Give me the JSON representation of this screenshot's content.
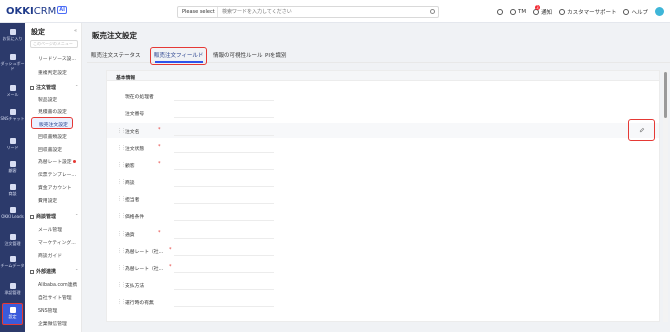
{
  "app": {
    "logo_main": "OKKI",
    "logo_crm": "CRM",
    "logo_ai": "AI"
  },
  "topbar": {
    "search_select": "Please select",
    "search_placeholder": "検索ワードを入力してください",
    "user": "TM",
    "notice": "通知",
    "notice_badge": "3",
    "support": "カスタマーサポート",
    "help": "ヘルプ"
  },
  "rail": {
    "items": [
      {
        "label": "お気に入り",
        "icon": "star-icon"
      },
      {
        "label": "ダッシュボード",
        "icon": "dashboard-icon"
      },
      {
        "label": "メール",
        "icon": "mail-icon"
      },
      {
        "label": "SNSチャット",
        "icon": "chat-icon"
      },
      {
        "label": "リード",
        "icon": "lead-icon"
      },
      {
        "label": "顧客",
        "icon": "customer-icon"
      },
      {
        "label": "商談",
        "icon": "deal-icon"
      },
      {
        "label": "OKKI Leads",
        "icon": "leads-icon"
      },
      {
        "label": "注文管理",
        "icon": "order-icon"
      },
      {
        "label": "チームデータ",
        "icon": "team-icon"
      },
      {
        "label": "承認管理",
        "icon": "approval-icon"
      },
      {
        "label": "設定",
        "icon": "settings-icon"
      }
    ]
  },
  "sidebar": {
    "title": "設定",
    "search_placeholder": "このページのメニュー",
    "items_top": [
      "リードソース設...",
      "重複判定設定"
    ],
    "groups": [
      {
        "label": "注文管理",
        "items": [
          "製品設定",
          "見積書の設定",
          "販売注文設定",
          "回収書類設定",
          "回収書設定",
          "為替レート設定",
          "伝票テンプレー...",
          "資金アカウント",
          "費用設定"
        ]
      },
      {
        "label": "商談管理",
        "items": [
          "メール管理",
          "マーケティング...",
          "商談ガイド"
        ]
      },
      {
        "label": "外部連携",
        "items": [
          "Alibaba.com連携",
          "自社サイト管理",
          "SNS管理",
          "企業微信管理"
        ]
      }
    ]
  },
  "main": {
    "title": "販売注文設定",
    "tabs": [
      "販売注文ステータス",
      "販売注文フィールド",
      "情報の可視性ルール",
      "PIを識別"
    ],
    "active_tab": 1,
    "section_title": "基本情報",
    "fields": [
      {
        "label": "現在の処理者",
        "required": false,
        "draggable": false
      },
      {
        "label": "注文番号",
        "required": false,
        "draggable": false
      },
      {
        "label": "注文名",
        "required": true,
        "draggable": true
      },
      {
        "label": "注文状態",
        "required": true,
        "draggable": true
      },
      {
        "label": "顧客",
        "required": true,
        "draggable": true
      },
      {
        "label": "商談",
        "required": false,
        "draggable": true
      },
      {
        "label": "担当者",
        "required": false,
        "draggable": true
      },
      {
        "label": "価格条件",
        "required": false,
        "draggable": true
      },
      {
        "label": "通貨",
        "required": true,
        "draggable": true
      },
      {
        "label": "為替レート（社...",
        "required": true,
        "draggable": true
      },
      {
        "label": "為替レート（社...",
        "required": true,
        "draggable": true
      },
      {
        "label": "支払方法",
        "required": false,
        "draggable": true
      },
      {
        "label": "運行時の有無",
        "required": false,
        "draggable": true
      }
    ]
  },
  "colors": {
    "accent": "#2f54eb",
    "rail_bg": "#2c3a6b",
    "highlight_box": "#e53935"
  }
}
